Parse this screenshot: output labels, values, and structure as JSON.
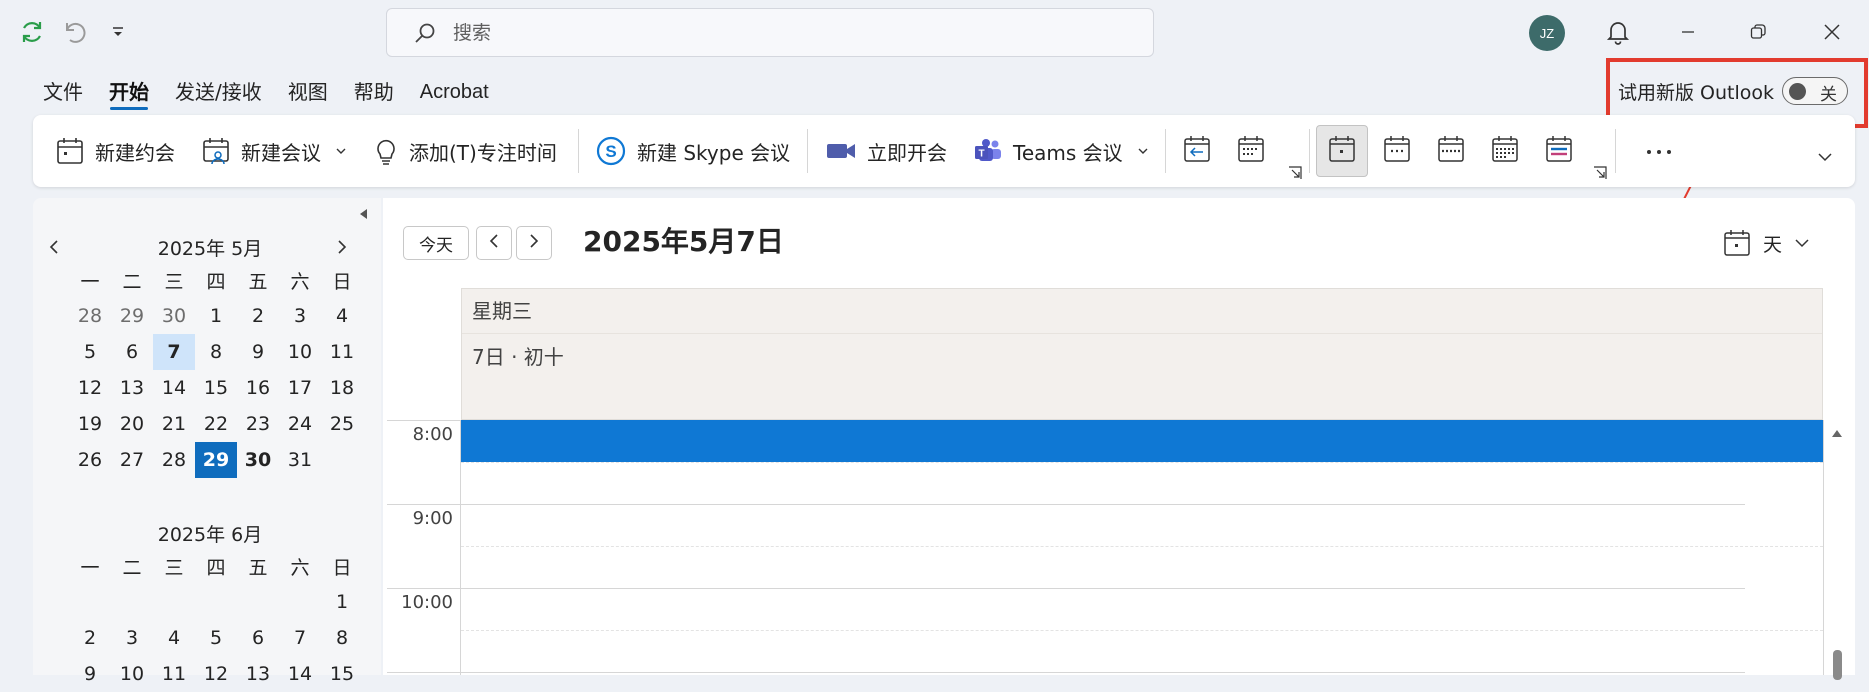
{
  "titlebar": {
    "search_placeholder": "搜索",
    "avatar_initials": "JZ"
  },
  "menu": {
    "tabs": [
      {
        "label": "文件"
      },
      {
        "label": "开始",
        "active": true
      },
      {
        "label": "发送/接收"
      },
      {
        "label": "视图"
      },
      {
        "label": "帮助"
      },
      {
        "label": "Acrobat"
      }
    ],
    "try_new_label": "试用新版 Outlook",
    "toggle_state": "关"
  },
  "ribbon": {
    "new_appointment": "新建约会",
    "new_meeting": "新建会议",
    "add_focus_time": "添加(T)专注时间",
    "new_skype_meeting": "新建 Skype 会议",
    "meet_now": "立即开会",
    "teams_meeting": "Teams 会议"
  },
  "mini_calendar": {
    "weekdays": [
      "一",
      "二",
      "三",
      "四",
      "五",
      "六",
      "日"
    ],
    "may": {
      "title": "2025年 5月",
      "weeks": [
        [
          "28",
          "29",
          "30",
          "1",
          "2",
          "3",
          "4"
        ],
        [
          "5",
          "6",
          "7",
          "8",
          "9",
          "10",
          "11"
        ],
        [
          "12",
          "13",
          "14",
          "15",
          "16",
          "17",
          "18"
        ],
        [
          "19",
          "20",
          "21",
          "22",
          "23",
          "24",
          "25"
        ],
        [
          "26",
          "27",
          "28",
          "29",
          "30",
          "31",
          ""
        ]
      ]
    },
    "june": {
      "title": "2025年 6月",
      "weeks": [
        [
          "",
          "",
          "",
          "",
          "",
          "",
          "1"
        ],
        [
          "2",
          "3",
          "4",
          "5",
          "6",
          "7",
          "8"
        ],
        [
          "9",
          "10",
          "11",
          "12",
          "13",
          "14",
          "15"
        ]
      ]
    }
  },
  "calendar": {
    "today_button": "今天",
    "date_title": "2025年5月7日",
    "view_label": "天",
    "weekday": "星期三",
    "lunar_date": "7日 · 初十",
    "times": [
      "8:00",
      "9:00",
      "10:00"
    ]
  },
  "colors": {
    "accent": "#0f6cbd",
    "event": "#0f78d4",
    "highlight": "#e23b2e"
  }
}
